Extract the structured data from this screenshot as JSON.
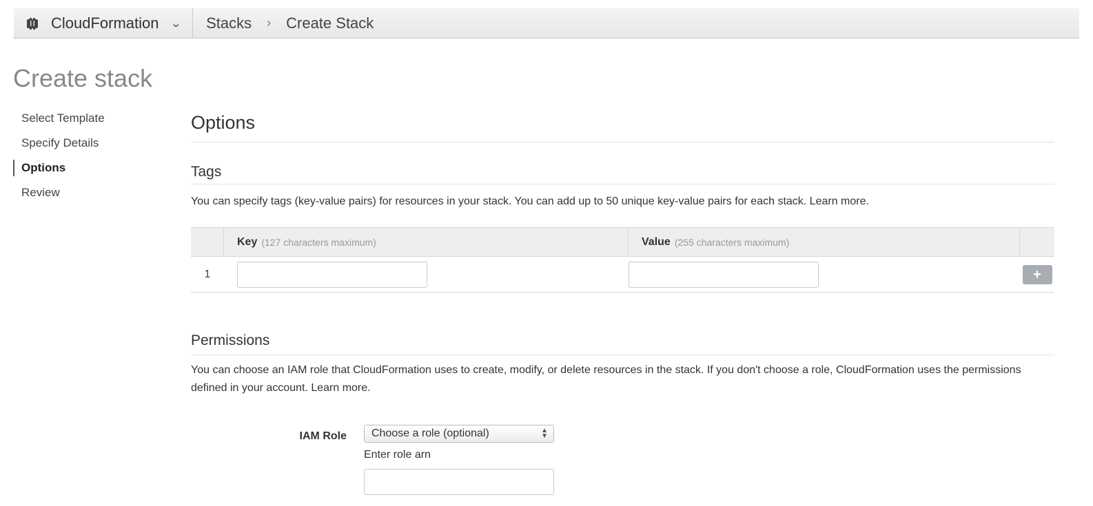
{
  "nav": {
    "service_name": "CloudFormation",
    "breadcrumb": {
      "parent": "Stacks",
      "separator": "›",
      "current": "Create Stack"
    }
  },
  "page_title": "Create stack",
  "steps": [
    {
      "label": "Select Template",
      "active": false
    },
    {
      "label": "Specify Details",
      "active": false
    },
    {
      "label": "Options",
      "active": true
    },
    {
      "label": "Review",
      "active": false
    }
  ],
  "options": {
    "title": "Options",
    "tags": {
      "title": "Tags",
      "description": "You can specify tags (key-value pairs) for resources in your stack. You can add up to 50 unique key-value pairs for each stack. Learn more.",
      "key_header": "Key",
      "key_hint": "(127 characters maximum)",
      "value_header": "Value",
      "value_hint": "(255 characters maximum)",
      "rows": [
        {
          "num": "1",
          "key": "",
          "value": ""
        }
      ],
      "add_label": "+"
    },
    "permissions": {
      "title": "Permissions",
      "description": "You can choose an IAM role that CloudFormation uses to create, modify, or delete resources in the stack. If you don't choose a role, CloudFormation uses the permissions defined in your account. Learn more.",
      "role_label": "IAM Role",
      "role_select_value": "Choose a role (optional)",
      "arn_label": "Enter role arn",
      "arn_value": ""
    }
  },
  "icons": {
    "service": "cloudformation-icon",
    "service_dropdown": "chevron-down-icon",
    "add": "plus-icon",
    "select_arrows": "updown-icon"
  },
  "colors": {
    "topbar_bg": "#ededed",
    "title_gray": "#888888",
    "add_button": "#a7adb3",
    "table_header_bg": "#eeeeee"
  }
}
